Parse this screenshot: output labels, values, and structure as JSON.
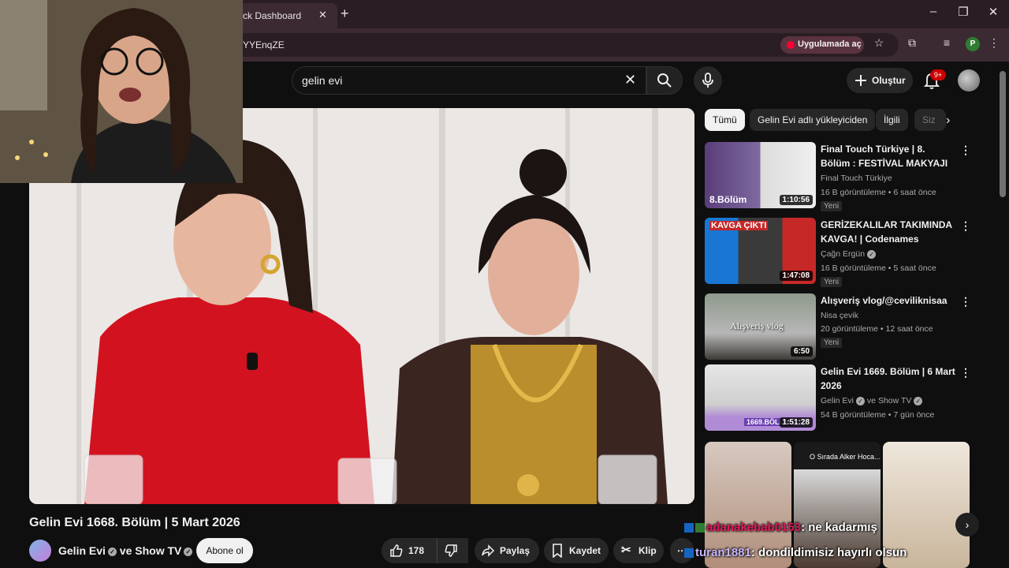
{
  "browser": {
    "tab_title": "ck Dashboard",
    "url": "YYEnqZE",
    "open_in_app": "Uygulamada aç",
    "profile_letter": "P",
    "colors": {
      "tabstrip": "#2b1d24",
      "toolbar": "#3c2a33"
    }
  },
  "header": {
    "search_query": "gelin evi",
    "create_label": "Oluştur",
    "notification_count": "9+"
  },
  "video": {
    "title": "Gelin Evi 1668. Bölüm | 5 Mart 2026",
    "channel": "Gelin Evi",
    "channel_connector": " ve ",
    "channel_partner": "Show TV",
    "subscribe_label": "Abone ol",
    "likes": "178",
    "share_label": "Paylaş",
    "save_label": "Kaydet",
    "clip_label": "Klip",
    "more_icon": "ellipsis"
  },
  "chips": [
    "Tümü",
    "Gelin Evi adlı yükleyiciden",
    "İlgili",
    "Siz"
  ],
  "recommendations": [
    {
      "title": "Final Touch Türkiye | 8. Bölüm : FESTİVAL MAKYAJI",
      "channel": "Final Touch Türkiye",
      "meta": "16 B görüntüleme • 6 saat önce",
      "badge": "Yeni",
      "duration": "1:10:56",
      "thumb_text": "8.Bölüm"
    },
    {
      "title": "GERİZEKALILAR TAKIMINDA KAVGA! | Codenames",
      "channel": "Çağn Ergün",
      "meta": "16 B görüntüleme • 5 saat önce",
      "badge": "Yeni",
      "duration": "1:47:08",
      "thumb_text": "KAVGA ÇIKTI"
    },
    {
      "title": "Alışveriş vlog/@ceviliknisaa",
      "channel": "Nisa çevik",
      "meta": "20 görüntüleme • 12 saat önce",
      "badge": "Yeni",
      "duration": "6:50",
      "thumb_text": "Alışveriş vlog"
    },
    {
      "title": "Gelin Evi 1669. Bölüm | 6 Mart 2026",
      "channel": "Gelin Evi",
      "channel_partner": "Show TV",
      "meta": "54 B görüntüleme • 7 gün önce",
      "badge": "",
      "duration": "1:51:28",
      "thumb_text": "1669.BÖLÜM"
    }
  ],
  "shorts_caption": "O Sırada Alker Hoca...",
  "chat": [
    {
      "user": "adanakebab0153",
      "message": ": ne kadarmış"
    },
    {
      "user": "turan1881",
      "message": ": dondildimisiz hayırlı olsun"
    }
  ]
}
